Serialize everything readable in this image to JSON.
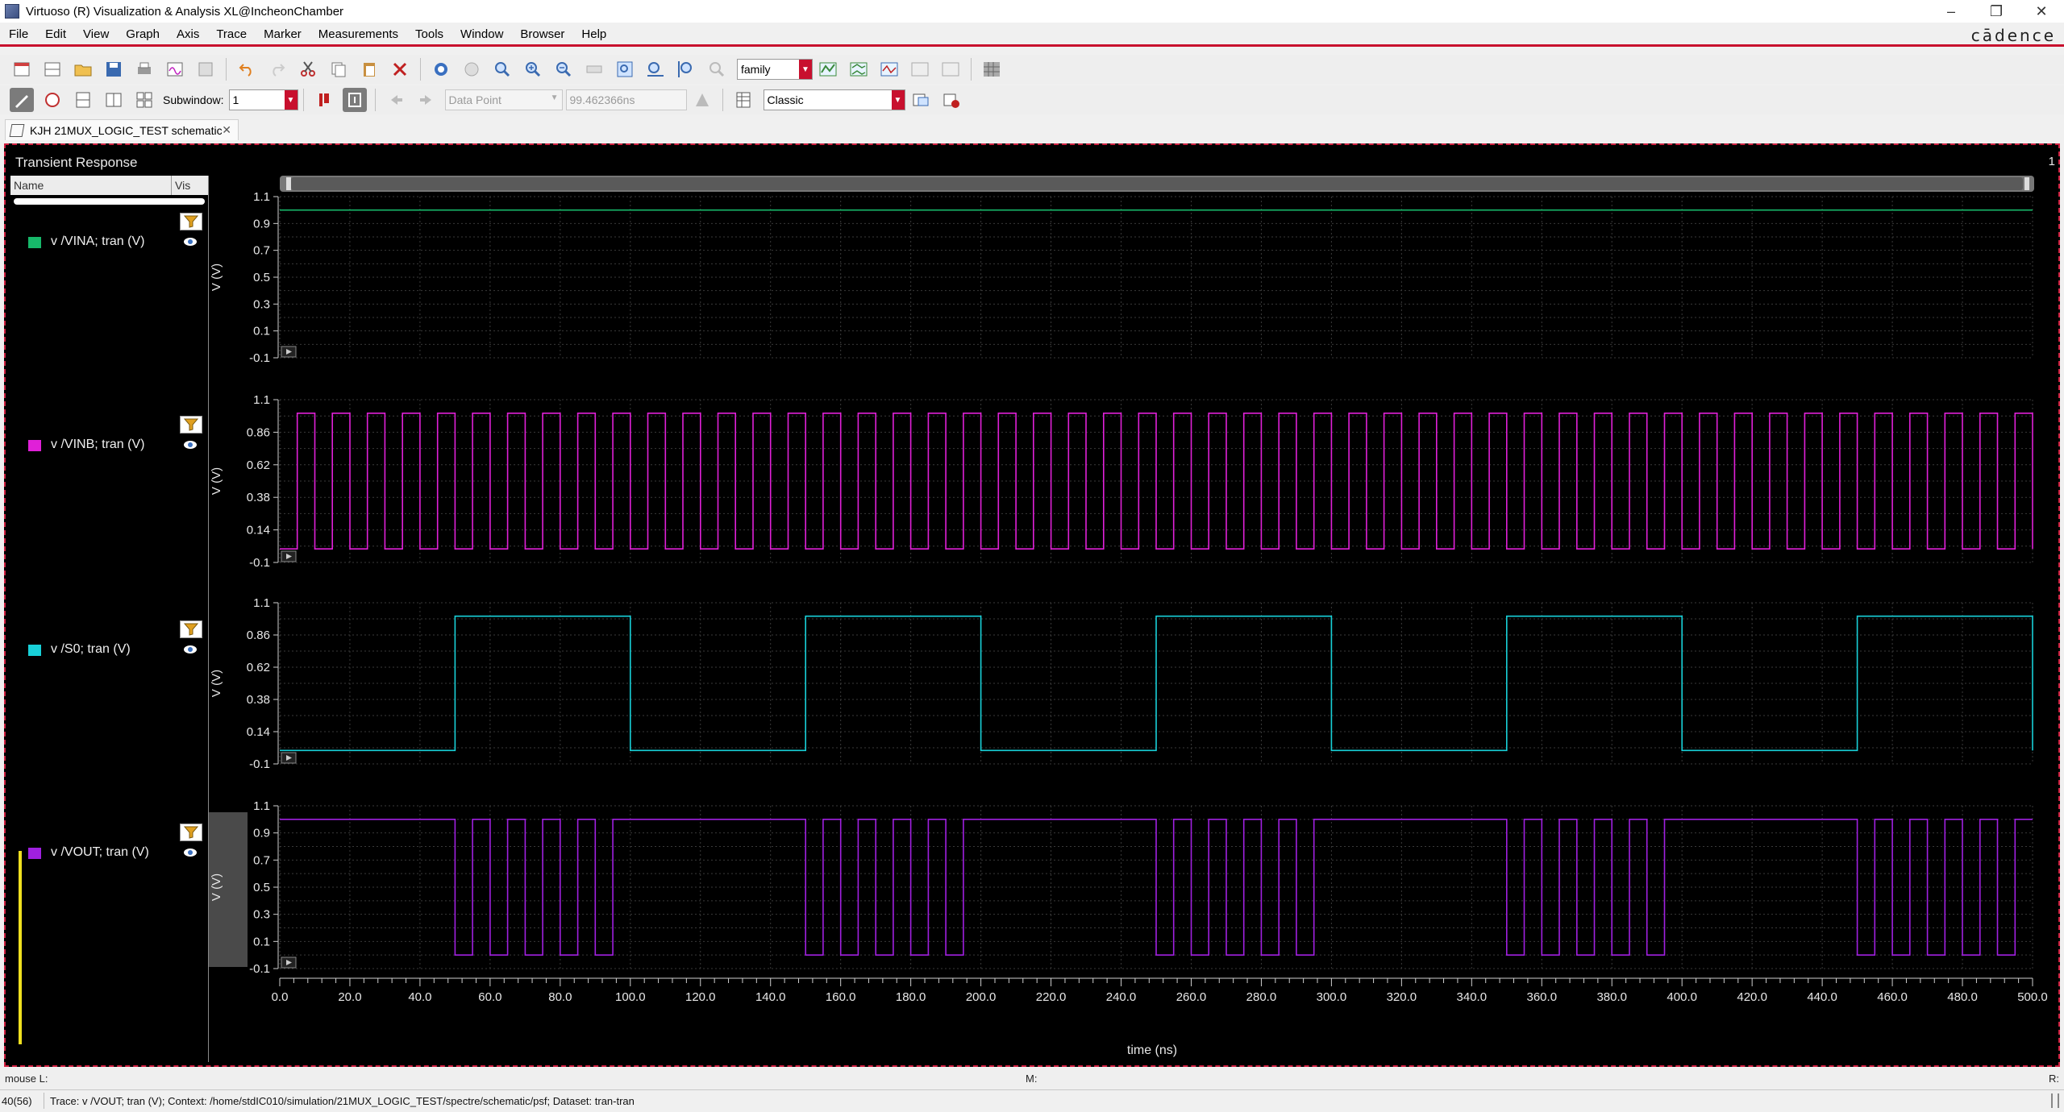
{
  "window": {
    "title": "Virtuoso (R) Visualization & Analysis XL@IncheonChamber",
    "minimize_glyph": "–",
    "restore_glyph": "❐",
    "close_glyph": "✕"
  },
  "menu": {
    "items": [
      "File",
      "Edit",
      "View",
      "Graph",
      "Axis",
      "Trace",
      "Marker",
      "Measurements",
      "Tools",
      "Window",
      "Browser",
      "Help"
    ],
    "brand": "cādence"
  },
  "toolbar1": {
    "family_value": "family"
  },
  "toolbar2": {
    "subwindow_label": "Subwindow:",
    "subwindow_value": "1",
    "marker_type": "Data Point",
    "marker_value": "99.462366ns",
    "style_value": "Classic"
  },
  "tab": {
    "label": "KJH 21MUX_LOGIC_TEST schematic",
    "close_glyph": "✕"
  },
  "plot": {
    "title": "Transient Response",
    "subwindow_number": "1",
    "legend_header_name": "Name",
    "legend_header_vis": "Vis",
    "xlabel": "time (ns)"
  },
  "colors": {
    "vina": "#17b86a",
    "vinb": "#e020d8",
    "s0": "#18d0d8",
    "vout": "#a020e0",
    "grid": "#3a3a3a",
    "brand_red": "#c8102e",
    "selection": "#f0e020"
  },
  "traces": [
    {
      "label": "v /VINA; tran (V)",
      "color": "#17b86a"
    },
    {
      "label": "v /VINB; tran (V)",
      "color": "#e020d8"
    },
    {
      "label": "v /S0; tran (V)",
      "color": "#18d0d8"
    },
    {
      "label": "v /VOUT; tran (V)",
      "color": "#a020e0"
    }
  ],
  "chart_data": [
    {
      "type": "line",
      "title": "",
      "xlabel": "time (ns)",
      "ylabel": "V (V)",
      "xlim": [
        0,
        500
      ],
      "ylim": [
        -0.1,
        1.1
      ],
      "yticks": [
        "1.1",
        "0.9",
        "0.7",
        "0.5",
        "0.3",
        "0.1",
        "-0.1"
      ],
      "series": [
        {
          "name": "v /VINA; tran (V)",
          "x": [
            0,
            500
          ],
          "y": [
            1.0,
            1.0
          ]
        }
      ]
    },
    {
      "type": "line",
      "title": "",
      "xlabel": "time (ns)",
      "ylabel": "V (V)",
      "xlim": [
        0,
        500
      ],
      "ylim": [
        -0.1,
        1.1
      ],
      "yticks": [
        "1.1",
        "0.86",
        "0.62",
        "0.38",
        "0.14",
        "-0.1"
      ],
      "series": [
        {
          "name": "v /VINB; tran (V)",
          "waveform": "square",
          "period_ns": 10,
          "low": 0.0,
          "high": 1.0,
          "first_high_at_ns": 5
        }
      ]
    },
    {
      "type": "line",
      "title": "",
      "xlabel": "time (ns)",
      "ylabel": "V (V)",
      "xlim": [
        0,
        500
      ],
      "ylim": [
        -0.1,
        1.1
      ],
      "yticks": [
        "1.1",
        "0.86",
        "0.62",
        "0.38",
        "0.14",
        "-0.1"
      ],
      "series": [
        {
          "name": "v /S0; tran (V)",
          "waveform": "square",
          "period_ns": 100,
          "low": 0.0,
          "high": 1.0,
          "first_high_at_ns": 50
        }
      ]
    },
    {
      "type": "line",
      "title": "",
      "xlabel": "time (ns)",
      "ylabel": "V (V)",
      "xlim": [
        0,
        500
      ],
      "ylim": [
        -0.1,
        1.1
      ],
      "yticks": [
        "1.1",
        "0.9",
        "0.7",
        "0.5",
        "0.3",
        "0.1",
        "-0.1"
      ],
      "series": [
        {
          "name": "v /VOUT; tran (V)",
          "low": 0.0,
          "high": 1.0,
          "note": "follows VINA when S0 low, VINB when S0 high"
        }
      ]
    }
  ],
  "xaxis": {
    "ticks": [
      "0.0",
      "20.0",
      "40.0",
      "60.0",
      "80.0",
      "100.0",
      "120.0",
      "140.0",
      "160.0",
      "180.0",
      "200.0",
      "220.0",
      "240.0",
      "260.0",
      "280.0",
      "300.0",
      "320.0",
      "340.0",
      "360.0",
      "380.0",
      "400.0",
      "420.0",
      "440.0",
      "460.0",
      "480.0",
      "500.0"
    ]
  },
  "status": {
    "mouse_l": "mouse L:",
    "mouse_m": "M:",
    "mouse_r": "R:",
    "count": "40(56)",
    "message": "Trace: v /VOUT; tran (V); Context: /home/stdIC010/simulation/21MUX_LOGIC_TEST/spectre/schematic/psf; Dataset: tran-tran"
  }
}
